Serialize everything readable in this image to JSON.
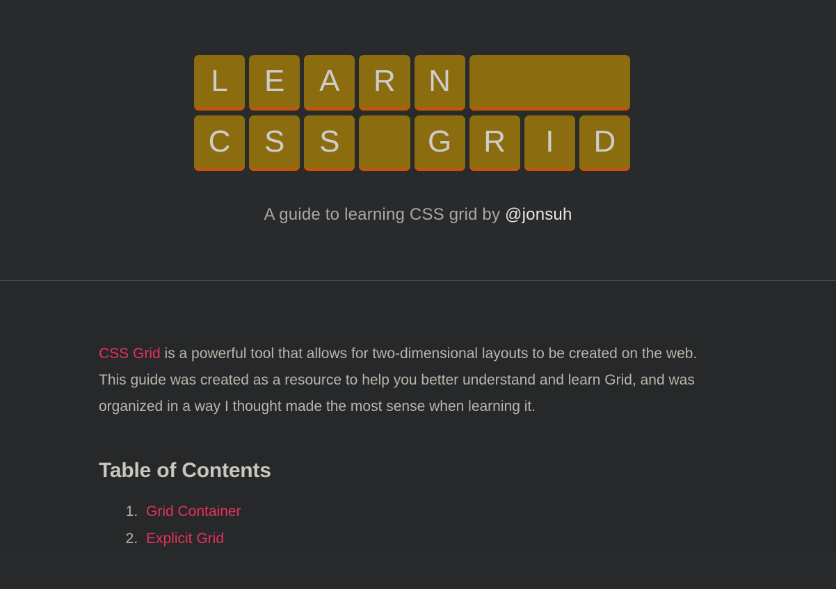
{
  "header": {
    "logo_rows": [
      [
        {
          "letter": "L",
          "span": 1,
          "blank": false
        },
        {
          "letter": "E",
          "span": 1,
          "blank": false
        },
        {
          "letter": "A",
          "span": 1,
          "blank": false
        },
        {
          "letter": "R",
          "span": 1,
          "blank": false
        },
        {
          "letter": "N",
          "span": 1,
          "blank": false
        },
        {
          "letter": "",
          "span": 3,
          "blank": true
        }
      ],
      [
        {
          "letter": "C",
          "span": 1,
          "blank": false
        },
        {
          "letter": "S",
          "span": 1,
          "blank": false
        },
        {
          "letter": "S",
          "span": 1,
          "blank": false
        },
        {
          "letter": "",
          "span": 1,
          "blank": true
        },
        {
          "letter": "G",
          "span": 1,
          "blank": false
        },
        {
          "letter": "R",
          "span": 1,
          "blank": false
        },
        {
          "letter": "I",
          "span": 1,
          "blank": false
        },
        {
          "letter": "D",
          "span": 1,
          "blank": false
        }
      ]
    ],
    "logo_text": "LEARN CSS GRID",
    "tagline_prefix": "A guide to learning CSS grid by ",
    "tagline_author": "@jonsuh"
  },
  "main": {
    "intro_link": "CSS Grid",
    "intro_rest": " is a powerful tool that allows for two-dimensional layouts to be created on the web. This guide was created as a resource to help you better understand and learn Grid, and was organized in a way I thought made the most sense when learning it.",
    "toc_heading": "Table of Contents",
    "toc_items": [
      {
        "label": "Grid Container"
      },
      {
        "label": "Explicit Grid"
      }
    ]
  },
  "colors": {
    "page_background": "#282a2b",
    "main_background": "#262829",
    "tile_background": "#8b6d0f",
    "tile_border_bottom": "#c1560b",
    "tile_letter": "#cdcdcb",
    "link_pink": "#e7325f",
    "body_text": "#b8b5ad",
    "divider": "#4b4e50"
  }
}
